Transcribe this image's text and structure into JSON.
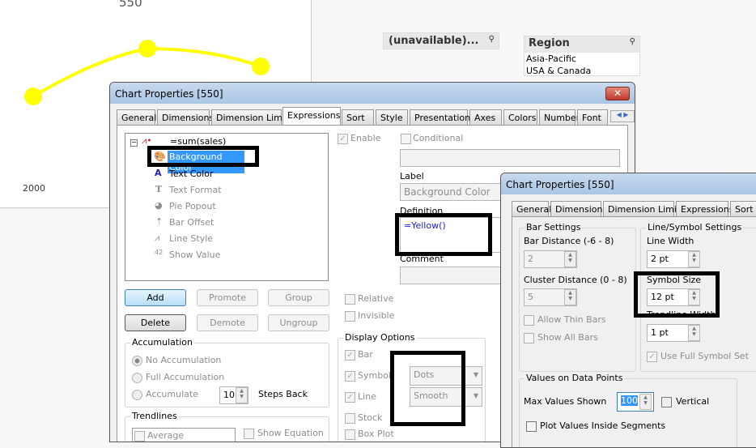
{
  "chart": {
    "title": "550",
    "x_label": "2000",
    "series_color": "#ffff00",
    "points": [
      {
        "y": "low"
      },
      {
        "y": "high"
      },
      {
        "y": "mid"
      }
    ]
  },
  "listboxes": [
    {
      "title": "(unavailable)...",
      "items": []
    },
    {
      "title": "Region",
      "items": [
        "Asia-Pacific",
        "USA & Canada"
      ]
    }
  ],
  "dialog1": {
    "title": "Chart Properties [550]",
    "tabs": [
      "General",
      "Dimensions",
      "Dimension Limits",
      "Expressions",
      "Sort",
      "Style",
      "Presentation",
      "Axes",
      "Colors",
      "Number",
      "Font"
    ],
    "selected_tab": "Expressions",
    "tree": {
      "root": "=sum(sales)",
      "items": [
        "Background Color",
        "Text Color",
        "Text Format",
        "Pie Popout",
        "Bar Offset",
        "Line Style",
        "Show Value"
      ],
      "selected": "Background Color"
    },
    "enable": "Enable",
    "conditional": "Conditional",
    "label_caption": "Label",
    "label_value": "Background Color",
    "definition_caption": "Definition",
    "definition_value": "=Yellow()",
    "comment_caption": "Comment",
    "buttons": [
      "Add",
      "Promote",
      "Group",
      "Delete",
      "Demote",
      "Ungroup"
    ],
    "relative": "Relative",
    "invisible": "Invisible",
    "accumulation": {
      "title": "Accumulation",
      "options": [
        "No Accumulation",
        "Full Accumulation",
        "Accumulate"
      ],
      "selected": "No Accumulation",
      "steps": "10",
      "steps_label": "Steps Back"
    },
    "trendlines": {
      "title": "Trendlines",
      "item": "Average",
      "show_equation": "Show Equation"
    },
    "display_options": {
      "title": "Display Options",
      "items": [
        "Bar",
        "Symbol",
        "Line",
        "Stock",
        "Box Plot"
      ],
      "symbol_value": "Dots",
      "line_value": "Smooth"
    }
  },
  "dialog2": {
    "title": "Chart Properties [550]",
    "tabs": [
      "General",
      "Dimensions",
      "Dimension Limits",
      "Expressions",
      "Sort"
    ],
    "bar_settings": {
      "title": "Bar Settings",
      "bar_distance_label": "Bar Distance (-6 - 8)",
      "bar_distance": "2",
      "cluster_distance_label": "Cluster Distance (0 - 8)",
      "cluster_distance": "5",
      "allow_thin": "Allow Thin Bars",
      "show_all": "Show All Bars"
    },
    "line_symbol": {
      "title": "Line/Symbol Settings",
      "line_width_label": "Line Width",
      "line_width": "2 pt",
      "symbol_size_label": "Symbol Size",
      "symbol_size": "12 pt",
      "trendline_width_label": "Trendline Width",
      "trendline_width": "1 pt",
      "use_full": "Use Full Symbol Set"
    },
    "values": {
      "title": "Values on Data Points",
      "max_label": "Max Values Shown",
      "max_value": "100",
      "vertical": "Vertical",
      "plot_inside": "Plot Values Inside Segments"
    }
  }
}
